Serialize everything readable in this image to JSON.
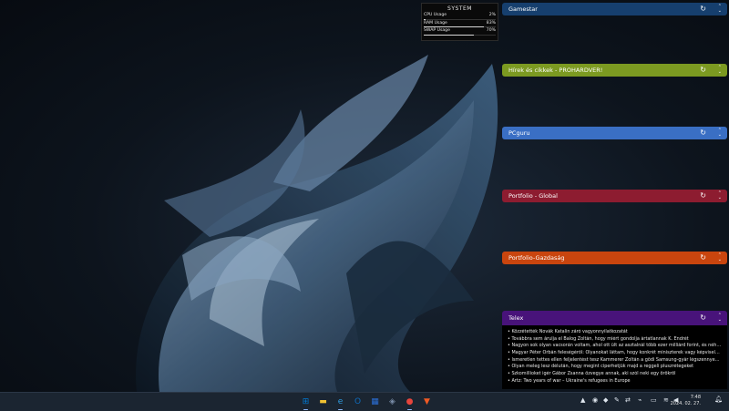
{
  "system_monitor": {
    "title": "SYSTEM",
    "rows": [
      {
        "label": "CPU Usage",
        "value": "2%",
        "level": 0.02
      },
      {
        "label": "RAM Usage",
        "value": "83%",
        "level": 0.83
      },
      {
        "label": "SWAP Usage",
        "value": "70%",
        "level": 0.7
      }
    ]
  },
  "feeds": [
    {
      "title": "Gamestar",
      "color": "#163f6e"
    },
    {
      "title": "Hírek és cikkek - PROHARDVER!",
      "color": "#7c9a21"
    },
    {
      "title": "PCguru",
      "color": "#3a6fc4"
    },
    {
      "title": "Portfolio - Global",
      "color": "#8d1c30"
    },
    {
      "title": "Portfolio-Gazdaság",
      "color": "#c9450e"
    },
    {
      "title": "Telex",
      "color": "#48137a"
    }
  ],
  "telex_items": [
    "• Közzétették Novák Katalin záró vagyonnyilatkozatát",
    "• Továbbra sem árulja el Balog Zoltán, hogy miért gondolja ártatlannak K. Endrét",
    "• Nagyon sok olyan vacsorán voltam, ahol ott ült az asztalnál több ezer milliárd forint, és néha...",
    "• Magyar Péter Orbán feleségéről: Olyanokat láttam, hogy konkrét miniszterek vagy képviselő...",
    "• Ismeretlen tettes ellen feljelentést tesz Kammerer Zoltán a gödi Samsung-gyár légszennyezett...",
    "• Olyan meleg lesz délután, hogy megint ciperhetjük majd a reggeli pluszrétegeket",
    "• Szkomillioket igér Gábor Zsanna özvegye annak, aki szól neki egy örökröl",
    "• Artz: Two years of war – Ukraine's refugees in Europe"
  ],
  "taskbar": {
    "apps": [
      {
        "name": "windows-start",
        "glyph": "⊞",
        "color": "#0078d4"
      },
      {
        "name": "file-explorer",
        "glyph": "▬",
        "color": "#f2c232"
      },
      {
        "name": "edge",
        "glyph": "e",
        "color": "#2d9be0"
      },
      {
        "name": "outlook",
        "glyph": "O",
        "color": "#0f6cbd"
      },
      {
        "name": "store",
        "glyph": "▦",
        "color": "#2b6fd6"
      },
      {
        "name": "explorer",
        "glyph": "◈",
        "color": "#7a8da8"
      },
      {
        "name": "chrome",
        "glyph": "●",
        "color": "#e8453c"
      },
      {
        "name": "brave",
        "glyph": "▼",
        "color": "#f05a24"
      }
    ],
    "clock_time": "7:48",
    "clock_date": "2024. 02. 27."
  }
}
